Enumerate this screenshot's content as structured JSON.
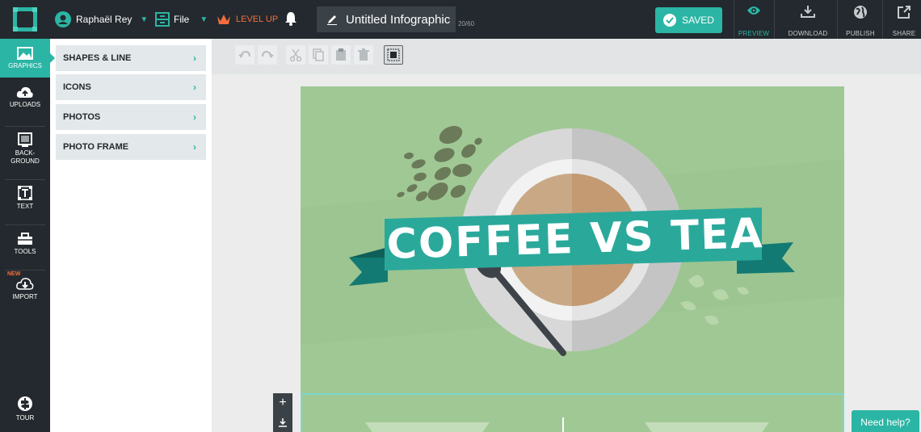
{
  "header": {
    "user_name": "Raphaël Rey",
    "file_label": "File",
    "levelup_label": "LEVEL UP",
    "doc_title": "Untitled Infographic",
    "doc_count": "20/60",
    "saved_label": "SAVED",
    "preview_label": "PREVIEW",
    "download_label": "DOWNLOAD",
    "publish_label": "PUBLISH",
    "share_label": "SHARE"
  },
  "leftnav": {
    "graphics": "GRAPHICS",
    "uploads": "UPLOADS",
    "background_line1": "BACK-",
    "background_line2": "GROUND",
    "text": "TEXT",
    "tools": "TOOLS",
    "new_tag": "NEW",
    "import": "IMPORT",
    "tour": "TOUR"
  },
  "panel": {
    "items": [
      {
        "label": "SHAPES & LINE"
      },
      {
        "label": "ICONS"
      },
      {
        "label": "PHOTOS"
      },
      {
        "label": "PHOTO FRAME"
      }
    ]
  },
  "canvas": {
    "banner_text": "COFFEE VS TEA"
  },
  "help": {
    "label": "Need help?"
  },
  "colors": {
    "accent": "#2bb5a4",
    "topbar": "#23292e",
    "levelup": "#f26d3d",
    "page_bg": "#a0c895",
    "banner": "#2aa99b",
    "banner_dark": "#137a73"
  }
}
